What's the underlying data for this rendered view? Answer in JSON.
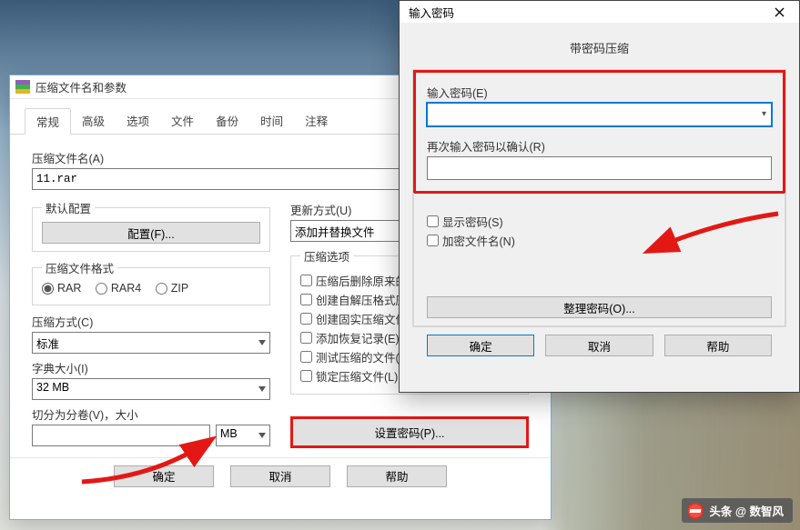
{
  "archive": {
    "title": "压缩文件名和参数",
    "tabs": [
      "常规",
      "高级",
      "选项",
      "文件",
      "备份",
      "时间",
      "注释"
    ],
    "active_tab": 0,
    "archive_name_label": "压缩文件名(A)",
    "archive_name_value": "11.rar",
    "default_profile_label": "默认配置",
    "profile_button": "配置(F)...",
    "format_group": "压缩文件格式",
    "formats": {
      "rar": "RAR",
      "rar4": "RAR4",
      "zip": "ZIP"
    },
    "format_selected": "rar",
    "method_label": "压缩方式(C)",
    "method_value": "标准",
    "dict_label": "字典大小(I)",
    "dict_value": "32 MB",
    "split_label": "切分为分卷(V)，大小",
    "split_value": "",
    "split_unit": "MB",
    "update_label": "更新方式(U)",
    "update_value": "添加并替换文件",
    "options_group": "压缩选项",
    "option_delete": "压缩后删除原来的文件(D)",
    "option_sfx": "创建自解压格式压缩文件(X)",
    "option_solid": "创建固实压缩文件(S)",
    "option_recovery": "添加恢复记录(E)",
    "option_test": "测试压缩的文件(T)",
    "option_lock": "锁定压缩文件(L)",
    "set_password_button": "设置密码(P)...",
    "buttons": {
      "ok": "确定",
      "cancel": "取消",
      "help": "帮助"
    }
  },
  "password": {
    "title": "输入密码",
    "subtitle": "带密码压缩",
    "enter_label": "输入密码(E)",
    "enter_value": "",
    "reenter_label": "再次输入密码以确认(R)",
    "reenter_value": "",
    "show_password": "显示密码(S)",
    "encrypt_names": "加密文件名(N)",
    "organize": "整理密码(O)...",
    "buttons": {
      "ok": "确定",
      "cancel": "取消",
      "help": "帮助"
    }
  },
  "watermark": "头条 @ 数智风"
}
